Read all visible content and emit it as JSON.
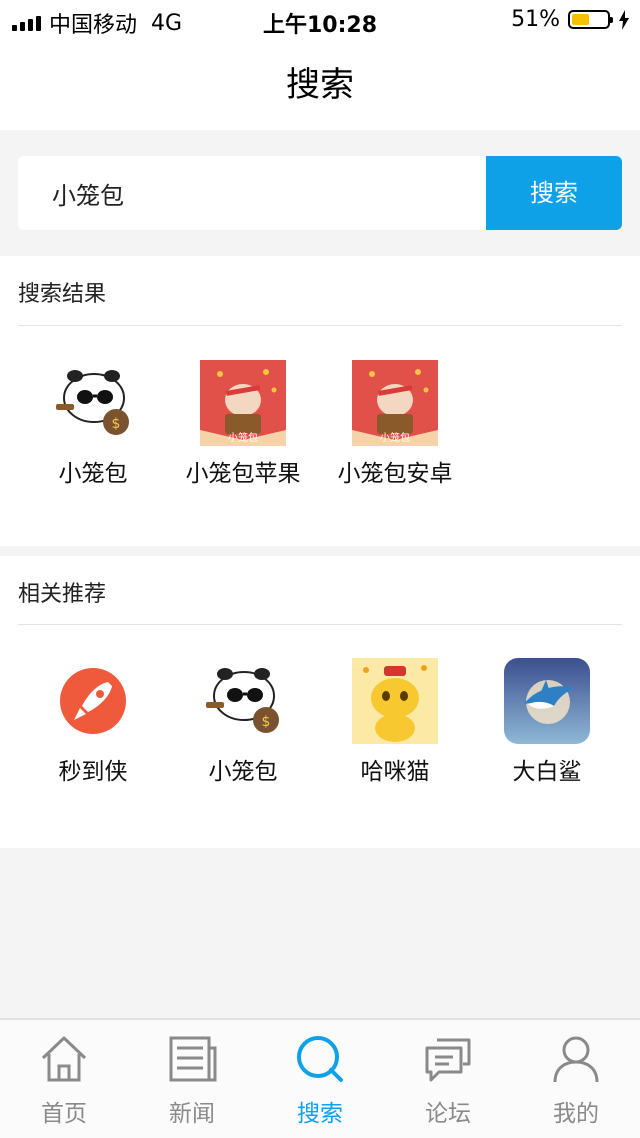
{
  "status_bar": {
    "carrier": "中国移动",
    "network": "4G",
    "time": "上午10:28",
    "battery": "51%",
    "battery_level": 0.51,
    "battery_color": "#f6c200"
  },
  "header": {
    "title": "搜索"
  },
  "search": {
    "value": "小笼包",
    "button_label": "搜索",
    "accent_color": "#0ea1e8"
  },
  "results": {
    "title": "搜索结果",
    "items": [
      {
        "label": "小笼包",
        "icon": "panda-sunglasses-icon"
      },
      {
        "label": "小笼包苹果",
        "icon": "bun-red-envelope-icon",
        "badge": "小笼包"
      },
      {
        "label": "小笼包安卓",
        "icon": "bun-red-envelope-icon",
        "badge": "小笼包"
      }
    ]
  },
  "recommendations": {
    "title": "相关推荐",
    "items": [
      {
        "label": "秒到侠",
        "icon": "rocket-icon"
      },
      {
        "label": "小笼包",
        "icon": "panda-sunglasses-icon"
      },
      {
        "label": "哈咪猫",
        "icon": "yellow-cat-icon"
      },
      {
        "label": "大白鲨",
        "icon": "shark-icon"
      }
    ]
  },
  "tabbar": {
    "items": [
      {
        "label": "首页",
        "icon": "home-icon"
      },
      {
        "label": "新闻",
        "icon": "news-icon"
      },
      {
        "label": "搜索",
        "icon": "search-icon",
        "active": true
      },
      {
        "label": "论坛",
        "icon": "chat-icon"
      },
      {
        "label": "我的",
        "icon": "user-icon"
      }
    ],
    "active_color": "#0ea1e8",
    "inactive_color": "#8a8a8a"
  }
}
